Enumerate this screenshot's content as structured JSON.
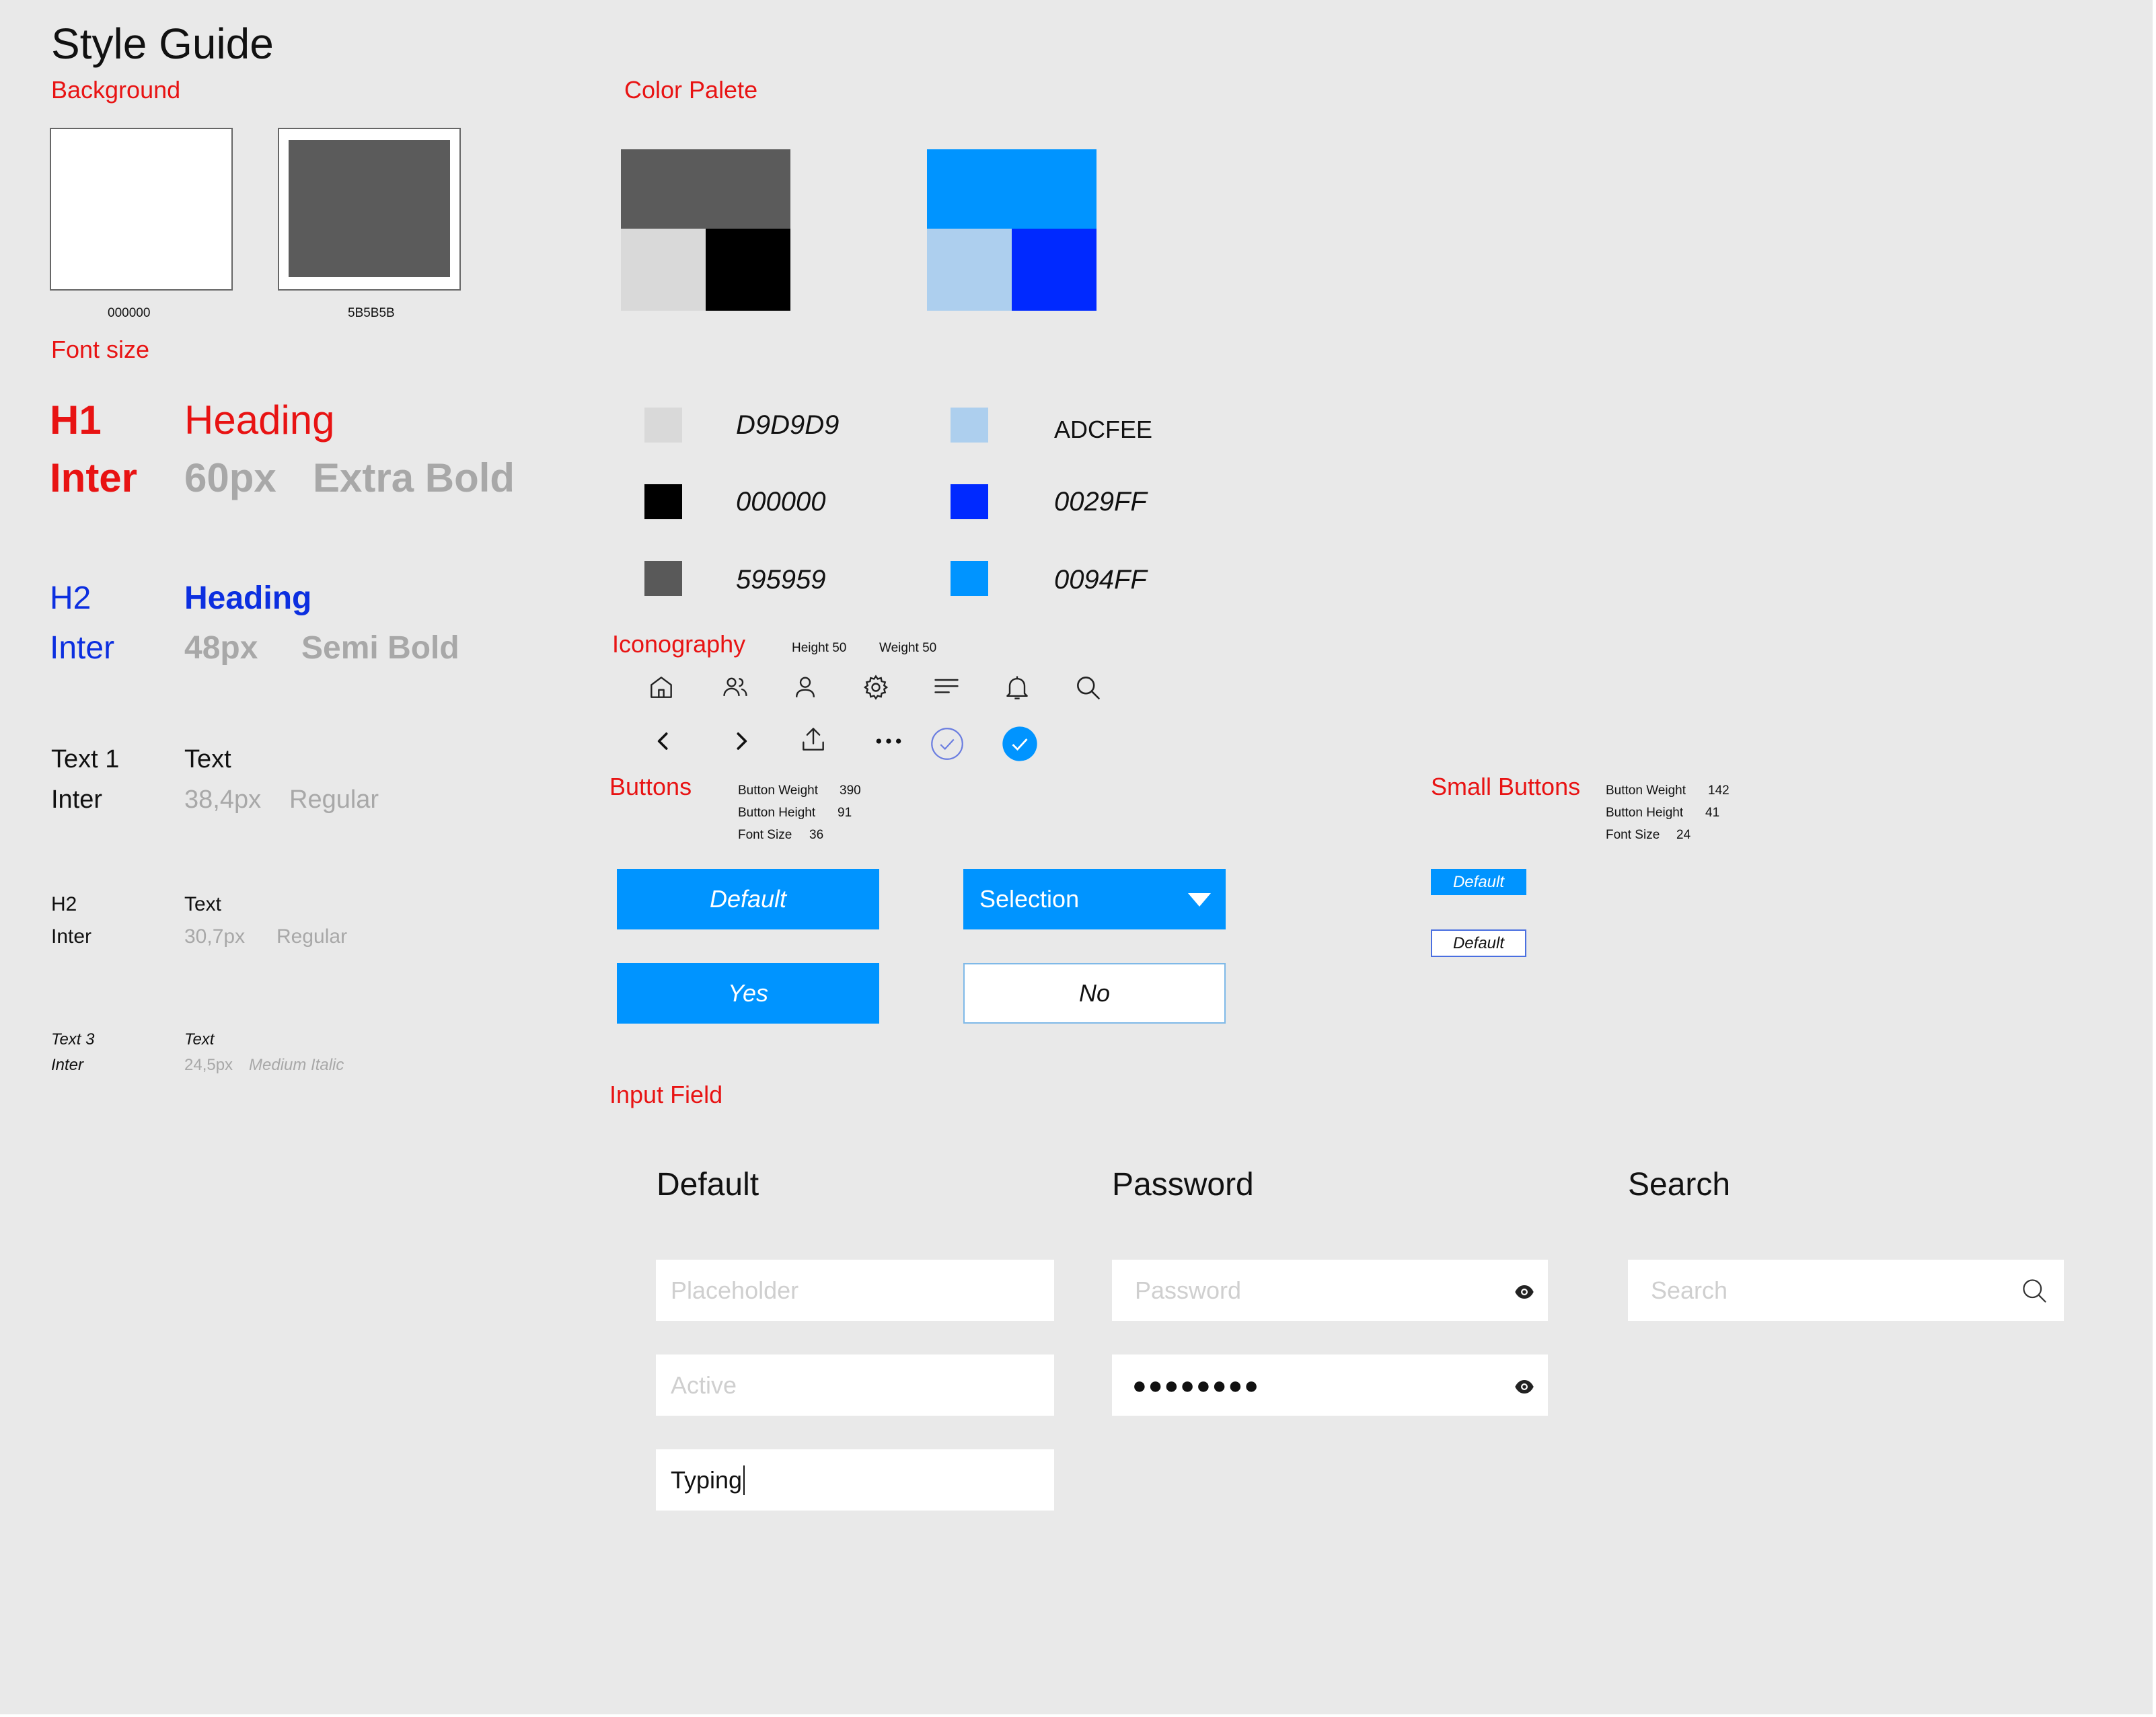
{
  "title": "Style Guide",
  "sections": {
    "background": "Background",
    "font_size": "Font size",
    "color_palete": "Color Palete",
    "iconography": "Iconography",
    "buttons": "Buttons",
    "small_buttons": "Small Buttons",
    "input_field": "Input Field"
  },
  "background": {
    "swatches": [
      {
        "label": "000000",
        "color": "#ffffff"
      },
      {
        "label": "5B5B5B",
        "color": "#5b5b5b"
      }
    ]
  },
  "typography": {
    "h1": {
      "tag": "H1",
      "family": "Inter",
      "sample": "Heading",
      "size": "60px",
      "weight": "Extra Bold",
      "color": "#e81313"
    },
    "h2": {
      "tag": "H2",
      "family": "Inter",
      "sample": "Heading",
      "size": "48px",
      "weight": "Semi Bold",
      "color": "#0c2fe0"
    },
    "text1": {
      "tag": "Text 1",
      "family": "Inter",
      "sample": "Text",
      "size": "38,4px",
      "weight": "Regular"
    },
    "text2": {
      "tag": "H2",
      "family": "Inter",
      "sample": "Text",
      "size": "30,7px",
      "weight": "Regular"
    },
    "text3": {
      "tag": "Text 3",
      "family": "Inter",
      "sample": "Text",
      "size": "24,5px",
      "weight": "Medium Italic"
    }
  },
  "palette": {
    "grey_group": [
      "#5b5b5b",
      "#d9d9d9",
      "#000000"
    ],
    "blue_group": [
      "#0094ff",
      "#adcfee",
      "#0029ff"
    ],
    "entries": [
      {
        "hex": "D9D9D9",
        "color": "#d9d9d9"
      },
      {
        "hex": "000000",
        "color": "#000000"
      },
      {
        "hex": "595959",
        "color": "#595959"
      },
      {
        "hex": "ADCFEE",
        "color": "#adcfee"
      },
      {
        "hex": "0029FF",
        "color": "#0029ff"
      },
      {
        "hex": "0094FF",
        "color": "#0094ff"
      }
    ]
  },
  "iconography": {
    "height": "Height 50",
    "weight": "Weight 50",
    "icons": [
      "home-icon",
      "users-icon",
      "user-icon",
      "gear-icon",
      "menu-icon",
      "bell-icon",
      "search-icon",
      "chevron-left-icon",
      "chevron-right-icon",
      "upload-icon",
      "more-icon",
      "check-outline-icon",
      "check-filled-icon"
    ]
  },
  "buttons": {
    "spec": {
      "weight_label": "Button Weight",
      "weight": "390",
      "height_label": "Button Height",
      "height": "91",
      "font_label": "Font Size",
      "font": "36"
    },
    "default": "Default",
    "selection": "Selection",
    "yes": "Yes",
    "no": "No",
    "primary_color": "#0094ff"
  },
  "small_buttons": {
    "spec": {
      "weight_label": "Button Weight",
      "weight": "142",
      "height_label": "Button Height",
      "height": "41",
      "font_label": "Font Size",
      "font": "24"
    },
    "filled": "Default",
    "outlined": "Default"
  },
  "inputs": {
    "default": {
      "heading": "Default",
      "placeholder": "Placeholder",
      "active": "Active",
      "typing": "Typing"
    },
    "password": {
      "heading": "Password",
      "placeholder": "Password",
      "masked": "●●●●●●●●"
    },
    "search": {
      "heading": "Search",
      "placeholder": "Search"
    }
  }
}
